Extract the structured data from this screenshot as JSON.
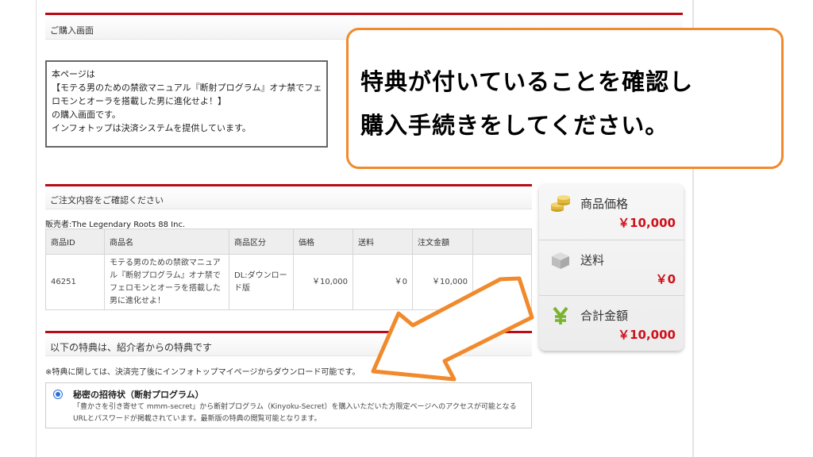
{
  "purchase_section": {
    "title": "ご購入画面"
  },
  "notice": {
    "lines": [
      "本ページは",
      "【モテる男のための禁欲マニュアル『断射プログラム』オナ禁でフェ",
      "ロモンとオーラを搭載した男に進化せよ！】",
      "の購入画面です。",
      "インフォトップは決済システムを提供しています。"
    ]
  },
  "callout": {
    "lines": [
      "特典が付いていることを確認し",
      "購入手続きをしてください。"
    ],
    "border_color": "#f08a2c"
  },
  "order_section": {
    "title": "ご注文内容をご確認ください"
  },
  "seller": "販売者:The Legendary Roots 88 Inc.",
  "order_table": {
    "headers": [
      "商品ID",
      "商品名",
      "商品区分",
      "価格",
      "送料",
      "注文金額"
    ],
    "rows": [
      {
        "id": "46251",
        "name": "モテる男のための禁欲マニュアル『断射プログラム』オナ禁でフェロモンとオーラを搭載した男に進化せよ！",
        "category": "DL:ダウンロード版",
        "price": "￥10,000",
        "shipping": "￥0",
        "total": "￥10,000"
      }
    ]
  },
  "summary": {
    "product_price_label": "商品価格",
    "product_price_value": "￥10,000",
    "shipping_label": "送料",
    "shipping_value": "￥0",
    "total_label": "合計金額",
    "total_value": "￥10,000",
    "icons": [
      "coins-icon",
      "box-icon",
      "yen-icon"
    ]
  },
  "bonus_section": {
    "title": "以下の特典は、紹介者からの特典です"
  },
  "bonus_note": "※特典に関しては、決済完了後にインフォトップマイページからダウンロード可能です。",
  "bonus": {
    "title": "秘密の招待状（断射プログラム）",
    "description": "「豊かさを引き寄せて mmm-secret」から断射プログラム（Kinyoku-Secret）を購入いただいた方限定ページへのアクセスが可能となるURLとパスワードが掲載されています。最新版の特典の閲覧可能となります。",
    "selected": true
  },
  "colors": {
    "accent_red": "#b80c16",
    "price_red": "#d0101a",
    "callout_orange": "#f08a2c"
  }
}
